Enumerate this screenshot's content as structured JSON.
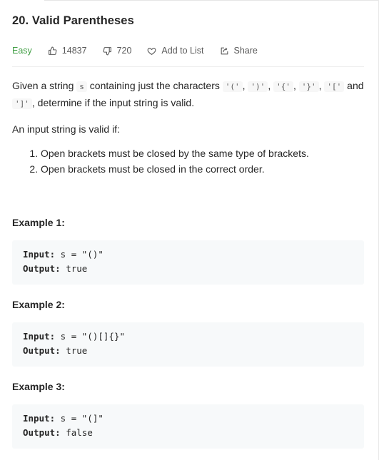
{
  "problem": {
    "title": "20. Valid Parentheses",
    "difficulty": "Easy",
    "likes": "14837",
    "dislikes": "720",
    "add_to_list": "Add to List",
    "share": "Share"
  },
  "description": {
    "p1_a": "Given a string ",
    "p1_code_s": "s",
    "p1_b": " containing just the characters ",
    "c1": "'('",
    "sep1": ", ",
    "c2": "')'",
    "sep2": ", ",
    "c3": "'{'",
    "sep3": ", ",
    "c4": "'}'",
    "sep4": ", ",
    "c5": "'['",
    "and": " and ",
    "c6": "']'",
    "p1_c": ", determine if the input string is valid.",
    "p2": "An input string is valid if:",
    "rules": [
      "Open brackets must be closed by the same type of brackets.",
      "Open brackets must be closed in the correct order."
    ]
  },
  "examples": [
    {
      "title": "Example 1:",
      "input_label": "Input:",
      "input": " s = \"()\"",
      "output_label": "Output:",
      "output": " true"
    },
    {
      "title": "Example 2:",
      "input_label": "Input:",
      "input": " s = \"()[]{}\"",
      "output_label": "Output:",
      "output": " true"
    },
    {
      "title": "Example 3:",
      "input_label": "Input:",
      "input": " s = \"(]\"",
      "output_label": "Output:",
      "output": " false"
    }
  ],
  "colors": {
    "difficulty_easy": "#43a047",
    "code_bg": "#f7f9fa",
    "text": "#262626",
    "meta": "#595959"
  }
}
